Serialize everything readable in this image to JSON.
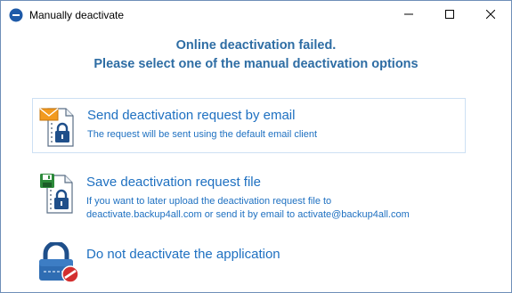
{
  "window": {
    "title": "Manually deactivate",
    "controls": [
      "minimize-icon",
      "maximize-icon",
      "close-icon"
    ]
  },
  "heading": {
    "line1": "Online deactivation failed.",
    "line2": "Please select one of the manual deactivation options"
  },
  "options": [
    {
      "title": "Send deactivation request by email",
      "desc_line1": "The request will be sent using the default email client",
      "icon": "email-lock-icon",
      "selected": true
    },
    {
      "title": "Save deactivation request file",
      "desc_line1": "If you want to later upload the deactivation request file to",
      "desc_line2": "deactivate.backup4all.com or send it by email to activate@backup4all.com",
      "icon": "save-file-lock-icon",
      "selected": false
    },
    {
      "title": "Do not deactivate the application",
      "icon": "lock-forbidden-icon",
      "selected": false
    }
  ],
  "colors": {
    "heading": "#2e6da4",
    "link": "#1e70c1",
    "selected_border": "#cde0f4"
  }
}
